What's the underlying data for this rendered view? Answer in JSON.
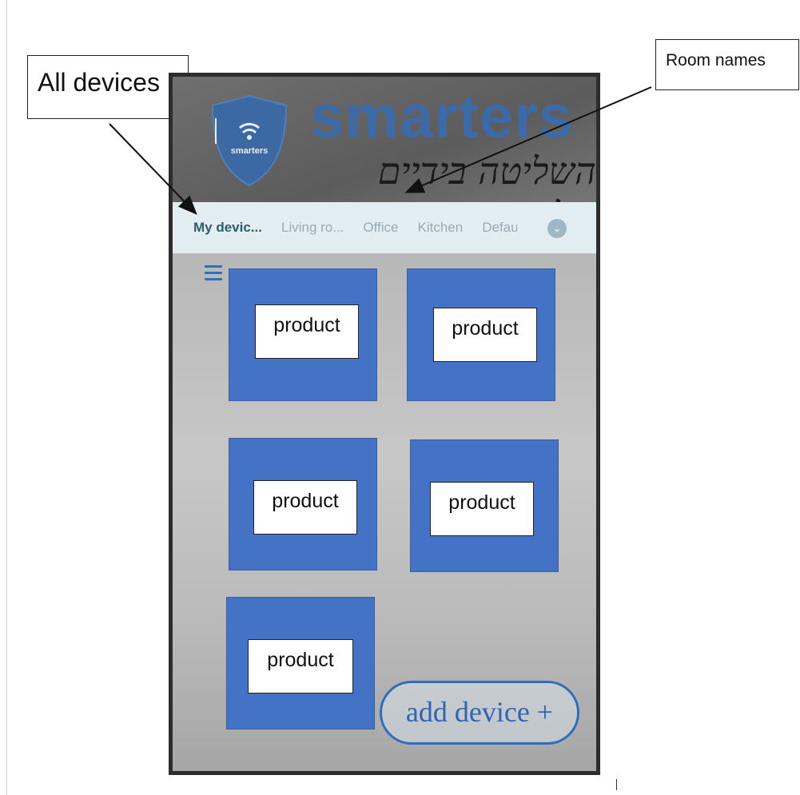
{
  "annotations": {
    "all_devices": "All devices",
    "room_names": "Room names"
  },
  "app": {
    "brand": "smarters",
    "shield_text": "smarters",
    "tagline": "השליטה בידיים שלך"
  },
  "tabs": [
    {
      "label": "My devic...",
      "active": true
    },
    {
      "label": "Living ro...",
      "active": false
    },
    {
      "label": "Office",
      "active": false
    },
    {
      "label": "Kitchen",
      "active": false
    },
    {
      "label": "Defau",
      "active": false
    }
  ],
  "tabs_more_icon": "chevron-down-icon",
  "menu_icon": "hamburger-menu-icon",
  "products": [
    {
      "label": "product"
    },
    {
      "label": "product"
    },
    {
      "label": "product"
    },
    {
      "label": "product"
    },
    {
      "label": "product"
    }
  ],
  "add_device": "add device +",
  "colors": {
    "tile": "#4472c4",
    "accent": "#2e6fbd",
    "tab_bar": "#e3eef3",
    "brand": "#3b6aa6"
  }
}
